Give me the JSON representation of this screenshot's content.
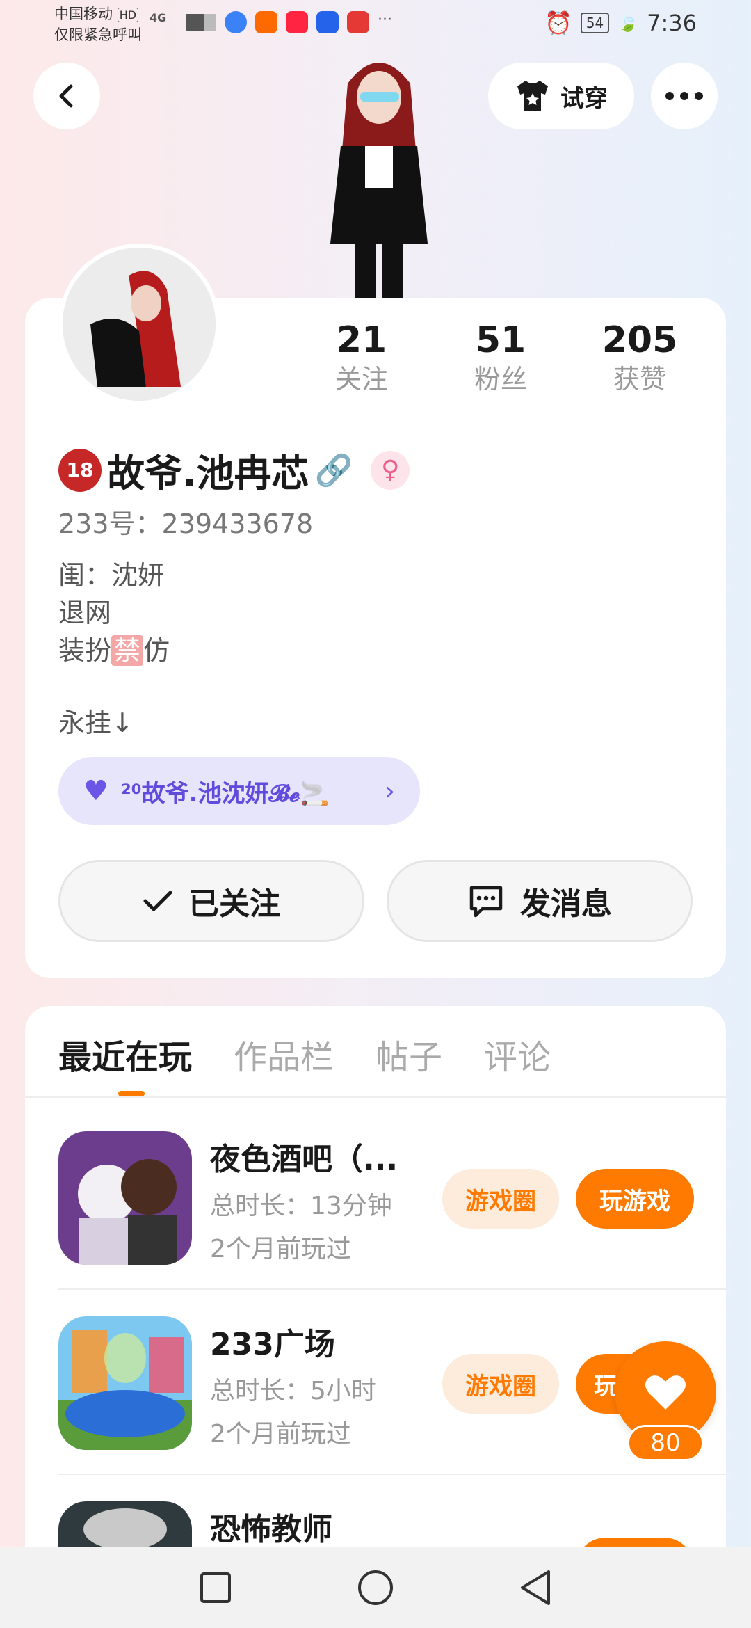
{
  "status_bar": {
    "carrier": "中国移动",
    "hd": "HD",
    "emergency": "仅限紧急呼叫",
    "network": "4G",
    "dots": "···",
    "battery": "54",
    "time": "7:36"
  },
  "header": {
    "tryon_label": "试穿"
  },
  "profile": {
    "following_count": "21",
    "following_label": "关注",
    "fans_count": "51",
    "fans_label": "粉丝",
    "likes_count": "205",
    "likes_label": "获赞",
    "age_badge": "18",
    "username": "故爷.池冉芯",
    "link_icon": "🔗",
    "gender_icon": "♀",
    "uid": "233号：239433678",
    "bio_line1": "闺：沈妍",
    "bio_line2": "退网",
    "bio_line3_pre": "装扮",
    "bio_line3_ban": "禁",
    "bio_line3_post": "仿",
    "pinned": "永挂↓",
    "couple_tag": "²⁰故爷.池沈妍𝓑𝓮🚬",
    "follow_button": "已关注",
    "message_button": "发消息"
  },
  "tabs": [
    {
      "label": "最近在玩",
      "active": true
    },
    {
      "label": "作品栏",
      "active": false
    },
    {
      "label": "帖子",
      "active": false
    },
    {
      "label": "评论",
      "active": false
    }
  ],
  "games": [
    {
      "title": "夜色酒吧（...",
      "duration": "总时长：13分钟",
      "last_played": "2个月前玩过",
      "circle_label": "游戏圈",
      "play_label": "玩游戏"
    },
    {
      "title": "233广场",
      "duration": "总时长：5小时",
      "last_played": "2个月前玩过",
      "circle_label": "游戏圈",
      "play_label": "玩"
    },
    {
      "title": "恐怖教师",
      "duration": "",
      "last_played": "",
      "circle_label": "",
      "play_label": ""
    }
  ],
  "fab": {
    "like_count": "80"
  },
  "colors": {
    "accent": "#ff7a00",
    "couple_pill_bg": "#e7e5fb",
    "couple_pill_text": "#5f4bdc"
  }
}
